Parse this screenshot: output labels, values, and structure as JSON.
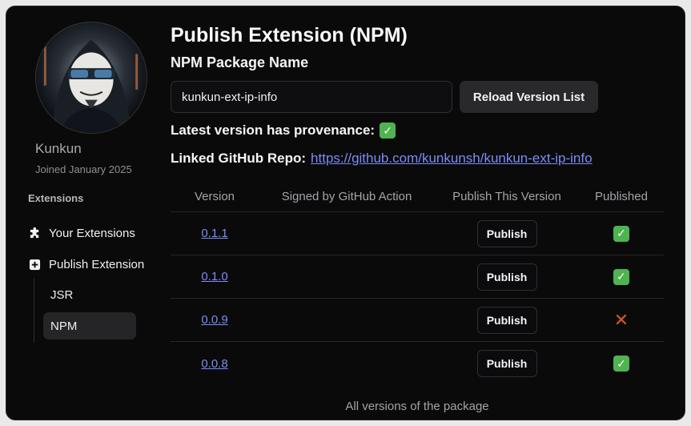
{
  "user": {
    "name": "Kunkun",
    "joined": "Joined January 2025"
  },
  "sidebar": {
    "section_label": "Extensions",
    "items": [
      {
        "label": "Your Extensions",
        "icon": "puzzle-icon"
      },
      {
        "label": "Publish Extension",
        "icon": "plus-square-icon"
      }
    ],
    "subitems": [
      {
        "label": "JSR",
        "active": false
      },
      {
        "label": "NPM",
        "active": true
      }
    ]
  },
  "main": {
    "title": "Publish Extension (NPM)",
    "subtitle": "NPM Package Name",
    "package_input_value": "kunkun-ext-ip-info",
    "reload_button": "Reload Version List",
    "provenance_label": "Latest version has provenance:",
    "provenance_status": "✓",
    "repo_label": "Linked GitHub Repo:",
    "repo_url": "https://github.com/kunkunsh/kunkun-ext-ip-info"
  },
  "table": {
    "headers": [
      "Version",
      "Signed by GitHub Action",
      "Publish This Version",
      "Published"
    ],
    "rows": [
      {
        "version": "0.1.1",
        "signed": "",
        "action": "Publish",
        "published": "✓"
      },
      {
        "version": "0.1.0",
        "signed": "",
        "action": "Publish",
        "published": "✓"
      },
      {
        "version": "0.0.9",
        "signed": "",
        "action": "Publish",
        "published": "✕"
      },
      {
        "version": "0.0.8",
        "signed": "",
        "action": "Publish",
        "published": "✓"
      }
    ],
    "caption": "All versions of the package"
  },
  "colors": {
    "background": "#0a0a0b",
    "link": "#7d8cf5",
    "check": "#4fb34f",
    "cross": "#d9552b"
  }
}
